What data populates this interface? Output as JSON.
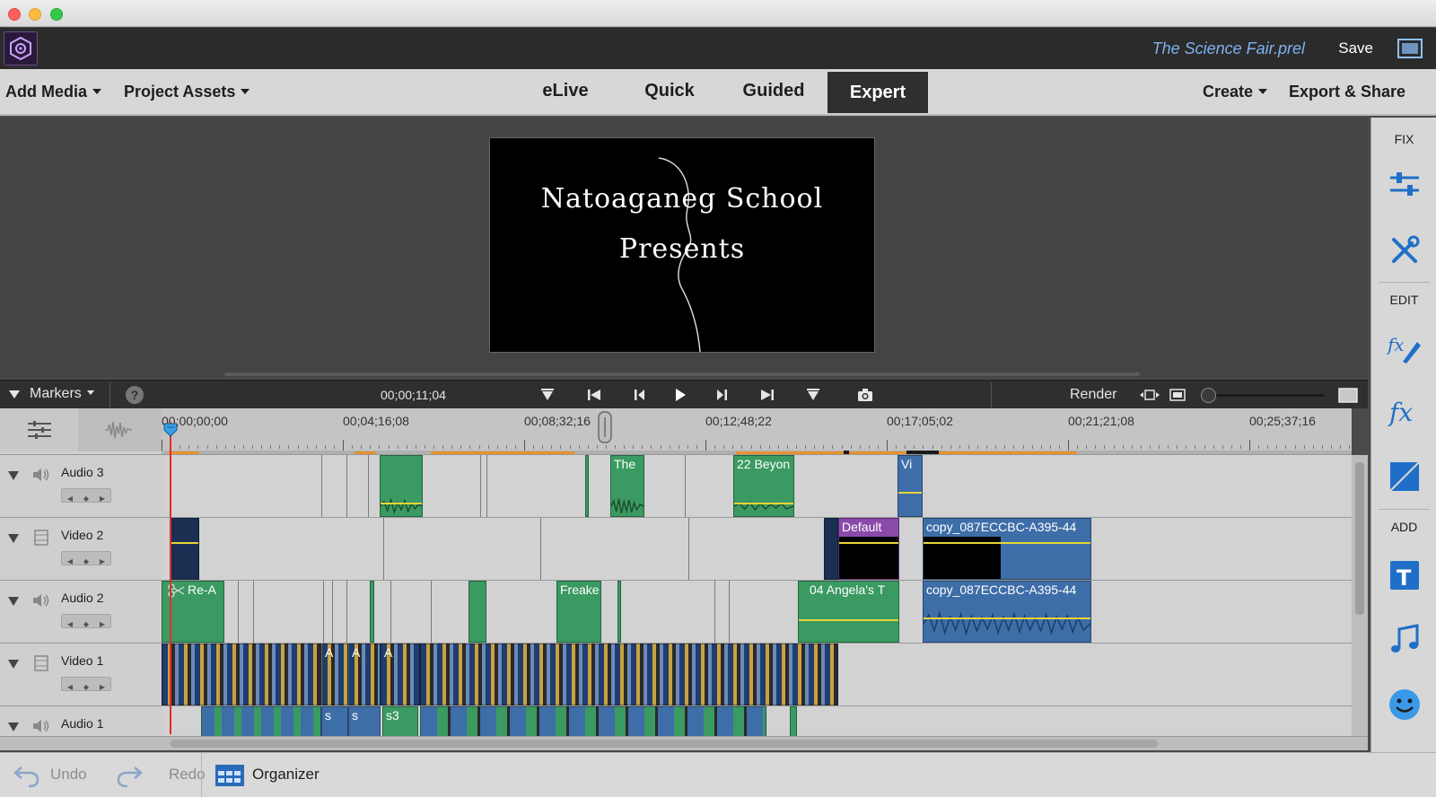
{
  "header": {
    "project_title": "The Science Fair.prel",
    "save_label": "Save"
  },
  "menubar": {
    "add_media": "Add Media",
    "project_assets": "Project Assets",
    "modes": [
      "eLive",
      "Quick",
      "Guided",
      "Expert"
    ],
    "active_mode": "Expert",
    "create": "Create",
    "export_share": "Export & Share"
  },
  "monitor": {
    "line1": "Natoaganeg School",
    "line2": "Presents"
  },
  "right_panel": {
    "fix_label": "FIX",
    "edit_label": "EDIT",
    "add_label": "ADD"
  },
  "timeline": {
    "markers_label": "Markers",
    "current_time": "00;00;11;04",
    "render_label": "Render",
    "ruler_labels": [
      "00;00;00;00",
      "00;04;16;08",
      "00;08;32;16",
      "00;12;48;22",
      "00;17;05;02",
      "00;21;21;08",
      "00;25;37;16"
    ],
    "tracks": [
      {
        "name": "Audio 3",
        "kind": "audio"
      },
      {
        "name": "Video 2",
        "kind": "video"
      },
      {
        "name": "Audio 2",
        "kind": "audio"
      },
      {
        "name": "Video 1",
        "kind": "video"
      },
      {
        "name": "Audio 1",
        "kind": "audio"
      }
    ],
    "clips": {
      "audio3_the": "The",
      "audio3_beyon": "22 Beyon",
      "audio3_vi": "Vi",
      "video2_default": "Default",
      "video2_copy": "copy_087ECCBC-A395-44",
      "audio2_rea": "Re-A",
      "audio2_freake": "Freake",
      "audio2_angela": "04 Angela's T",
      "audio2_copy": "copy_087ECCBC-A395-44",
      "video1_a1": "A",
      "video1_a2": "A",
      "video1_a3": "A",
      "audio1_s1": "s",
      "audio1_s2": "s",
      "audio1_s3": "s3"
    }
  },
  "bottombar": {
    "undo": "Undo",
    "redo": "Redo",
    "organizer": "Organizer"
  },
  "colors": {
    "accent_title": "#7fb2f0",
    "clip_green": "#3a9a62",
    "clip_blue": "#3e6ea8",
    "clip_purple": "#8a4aaa",
    "playhead": "#e82a2a",
    "icon_blue": "#1f6fc8"
  }
}
